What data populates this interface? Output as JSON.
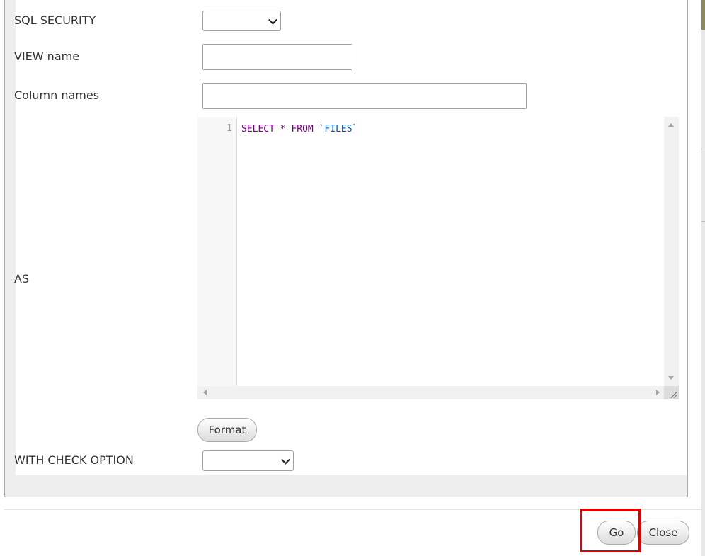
{
  "form": {
    "sql_security": {
      "label": "SQL SECURITY",
      "selected": ""
    },
    "view_name": {
      "label": "VIEW name",
      "value": ""
    },
    "column_names": {
      "label": "Column names",
      "value": ""
    },
    "as": {
      "label": "AS",
      "line_number": "1",
      "code": {
        "keyword1": "SELECT",
        "operator": "*",
        "keyword2": "FROM",
        "identifier": "`FILES`"
      }
    },
    "format_button": "Format",
    "with_check_option": {
      "label": "WITH CHECK OPTION",
      "selected": ""
    }
  },
  "footer": {
    "go_button": "Go",
    "close_button": "Close"
  },
  "colors": {
    "keyword": "#770088",
    "identifier": "#0055aa",
    "highlight": "#e00000"
  }
}
